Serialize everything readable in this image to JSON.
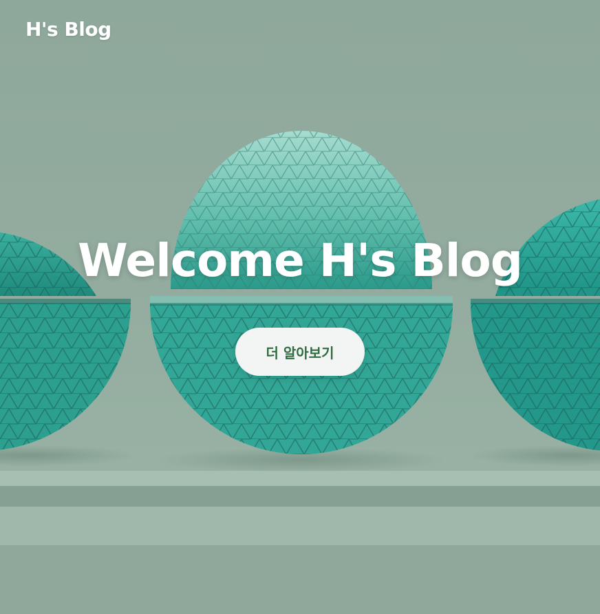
{
  "header": {
    "brand": "H's Blog"
  },
  "hero": {
    "title": "Welcome H's Blog",
    "cta_label": "더 알아보기"
  },
  "colors": {
    "background": "#93ac9f",
    "sphere_teal": "#2fa191",
    "sphere_light": "#8fd1c3",
    "cta_background": "#f2f5f3",
    "cta_text": "#2e6b3e",
    "text": "#ffffff"
  }
}
